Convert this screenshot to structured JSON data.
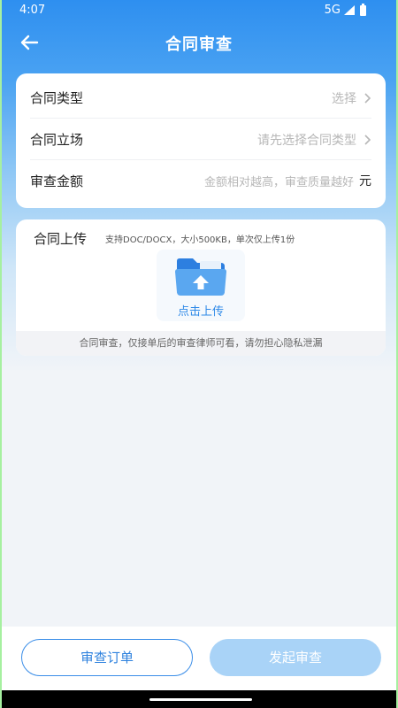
{
  "status_bar": {
    "time": "4:07",
    "network": "5G"
  },
  "header": {
    "title": "合同审查",
    "back_icon": "arrow-left-icon"
  },
  "form": {
    "contract_type": {
      "label": "合同类型",
      "value": "选择"
    },
    "contract_position": {
      "label": "合同立场",
      "value": "请先选择合同类型"
    },
    "review_amount": {
      "label": "审查金额",
      "placeholder": "金额相对越高，审查质量越好",
      "unit": "元"
    }
  },
  "upload": {
    "title": "合同上传",
    "hint": "支持DOC/DOCX，大小500KB，单次仅上传1份",
    "button_label": "点击上传",
    "privacy_note": "合同审查，仅接单后的审查律师可看，请勿担心隐私泄漏"
  },
  "bottom": {
    "order_label": "审查订单",
    "submit_label": "发起审查"
  },
  "colors": {
    "primary": "#2e8ff0",
    "submit_disabled": "#a9d3f7",
    "order_border": "#3b8ee8"
  }
}
